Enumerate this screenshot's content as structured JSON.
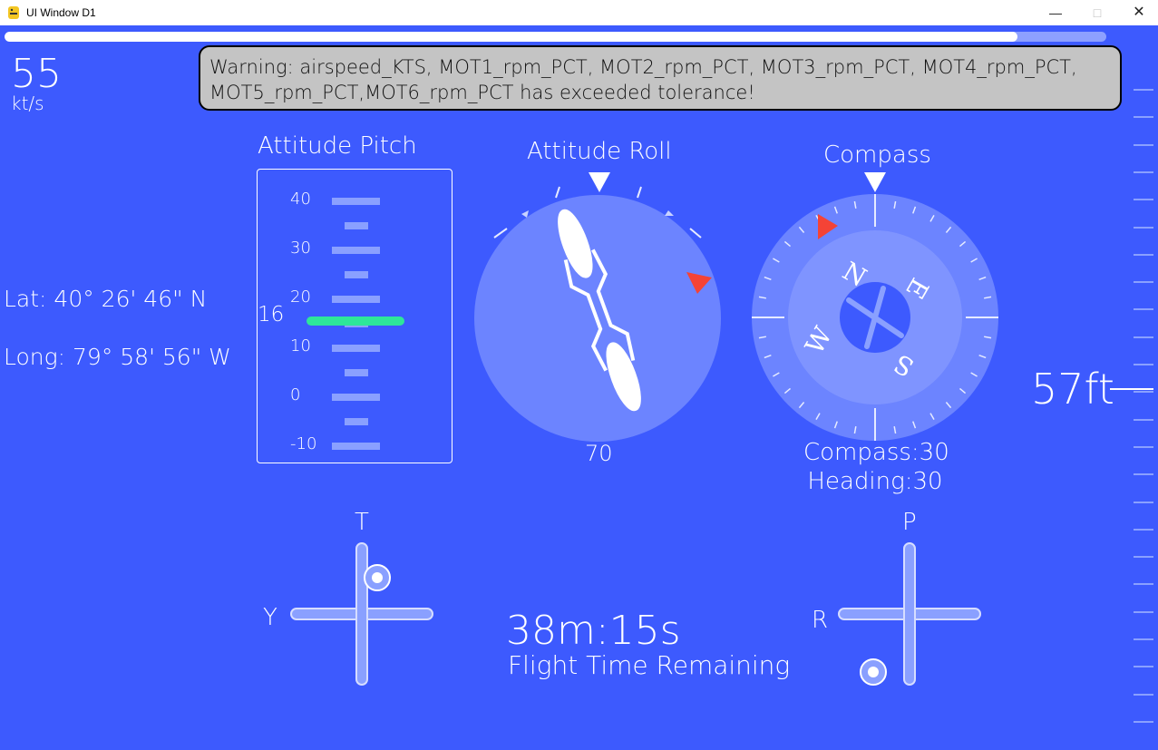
{
  "window": {
    "title": "UI Window D1",
    "minimize": "—",
    "maximize": "□",
    "close": "✕"
  },
  "progress": {
    "fraction": 0.919
  },
  "airspeed": {
    "value": "55",
    "unit": "kt/s"
  },
  "warning": {
    "text": "Warning: airspeed_KTS, MOT1_rpm_PCT, MOT2_rpm_PCT, MOT3_rpm_PCT, MOT4_rpm_PCT, MOT5_rpm_PCT,MOT6_rpm_PCT has exceeded tolerance!"
  },
  "position": {
    "lat": "Lat: 40° 26' 46\" N",
    "long": "Long: 79° 58' 56\" W"
  },
  "pitch": {
    "title": "Attitude Pitch",
    "labels": [
      "40",
      "30",
      "20",
      "10",
      "0",
      "-10"
    ],
    "value": "16"
  },
  "roll": {
    "title": "Attitude Roll",
    "value": "70"
  },
  "compass": {
    "title": "Compass",
    "letters": {
      "n": "N",
      "e": "E",
      "s": "S",
      "w": "W"
    },
    "compass_line": "Compass:30",
    "heading_line": "Heading:30"
  },
  "altitude": {
    "value": "57ft"
  },
  "sticks": {
    "left": {
      "top": "T",
      "side": "Y"
    },
    "right": {
      "top": "P",
      "side": "R"
    }
  },
  "flight": {
    "time": "38m:15s",
    "label": "Flight Time Remaining"
  },
  "colors": {
    "background": "#3d5afe",
    "accent_green": "#2ee69a",
    "marker_red": "#f44336",
    "warning_bg": "#c4c4c4"
  }
}
